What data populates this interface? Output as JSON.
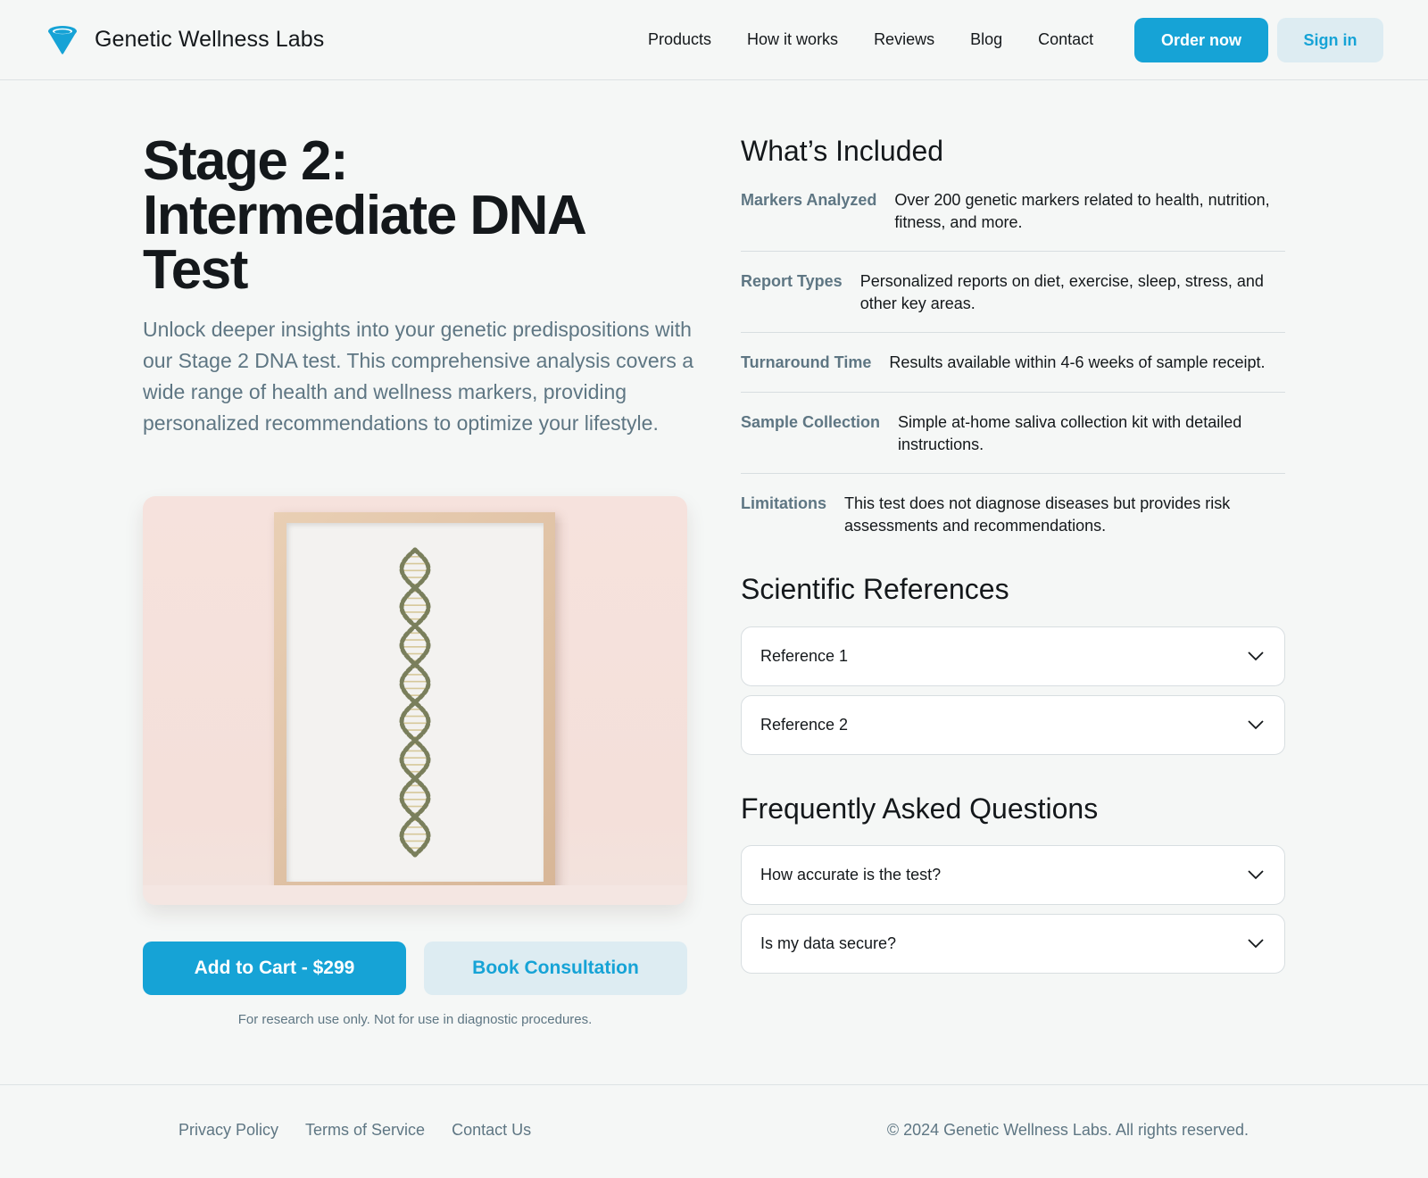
{
  "brand": {
    "name": "Genetic Wellness Labs",
    "logo_icon": "funnel-logo-icon",
    "accent": "#16a3d6"
  },
  "nav": {
    "items": [
      "Products",
      "How it works",
      "Reviews",
      "Blog",
      "Contact"
    ]
  },
  "header_actions": {
    "order_label": "Order now",
    "signin_label": "Sign in"
  },
  "product": {
    "title_lines": [
      "Stage 2:",
      "Intermediate DNA",
      "Test"
    ],
    "description": "Unlock deeper insights into your genetic predispositions with our Stage 2 DNA test. This comprehensive analysis covers a wide range of health and wellness markers, providing personalized recommendations to optimize your lifestyle.",
    "image_subject": "framed DNA double helix",
    "cart_label": "Add to Cart - $299",
    "consult_label": "Book Consultation",
    "disclaimer": "For research use only. Not for use in diagnostic procedures."
  },
  "included": {
    "heading": "What’s Included",
    "rows": [
      {
        "label": "Markers Analyzed",
        "value": "Over 200 genetic markers related to health, nutrition, fitness, and more."
      },
      {
        "label": "Report Types",
        "value": "Personalized reports on diet, exercise, sleep, stress, and other key areas."
      },
      {
        "label": "Turnaround Time",
        "value": "Results available within 4-6 weeks of sample receipt."
      },
      {
        "label": "Sample Collection",
        "value": "Simple at-home saliva collection kit with detailed instructions."
      },
      {
        "label": "Limitations",
        "value": "This test does not diagnose diseases but provides risk assessments and recommendations."
      }
    ]
  },
  "references": {
    "heading": "Scientific References",
    "items": [
      "Reference 1",
      "Reference 2"
    ]
  },
  "faq": {
    "heading": "Frequently Asked Questions",
    "items": [
      "How accurate is the test?",
      "Is my data secure?"
    ]
  },
  "footer": {
    "links": [
      "Privacy Policy",
      "Terms of Service",
      "Contact Us"
    ],
    "copyright": "© 2024 Genetic Wellness Labs. All rights reserved."
  }
}
